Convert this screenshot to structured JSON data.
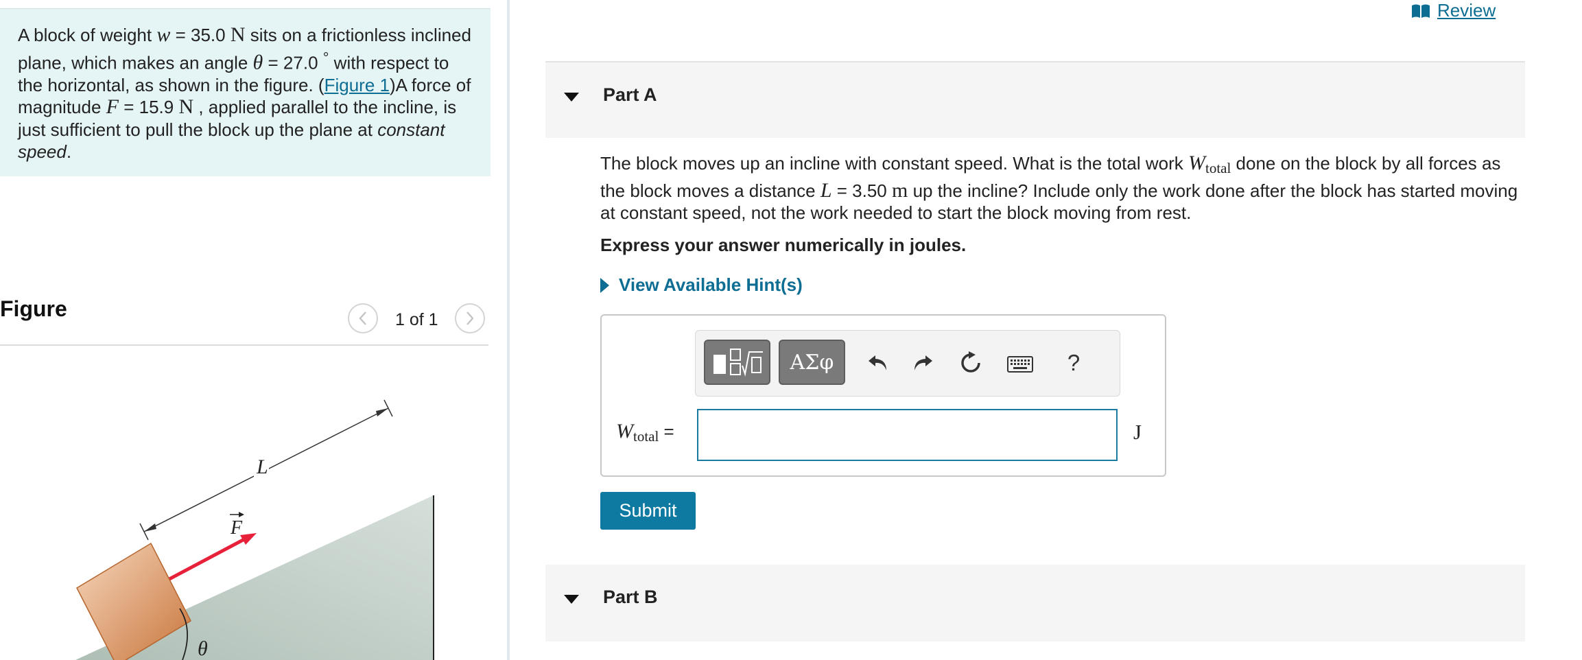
{
  "problem": {
    "part1": "A block of weight ",
    "w_symbol": "w",
    "part2": " = 35.0 ",
    "unit_N1": "N",
    "part3": " sits on a frictionless inclined plane, which makes an angle ",
    "theta_symbol": "θ",
    "part4": " = 27.0 ",
    "degree": "°",
    "part5": " with respect to the horizontal, as shown in the figure. (",
    "figure_link": "Figure 1",
    "part6": ")A force of magnitude ",
    "F_symbol": "F",
    "part7": " = 15.9 ",
    "unit_N2": "N",
    "part8": " , applied parallel to the incline, is just sufficient to pull the block up the plane at ",
    "emphasis": "constant speed",
    "part9": "."
  },
  "figure": {
    "title": "Figure",
    "counter": "1 of 1",
    "label_L": "L",
    "label_F": "F",
    "label_theta": "θ"
  },
  "review": {
    "label": "Review",
    "icon": "book-icon"
  },
  "partA": {
    "title": "Part A",
    "question_pre": "The block moves up an incline with constant speed. What is the total work ",
    "W_symbol": "W",
    "W_sub": "total",
    "question_mid": " done on the block by all forces as the block moves a distance ",
    "L_symbol": "L",
    "question_mid2": " = 3.50 ",
    "m_unit": "m",
    "question_post": " up the incline? Include only the work done after the block has started moving at constant speed, not the work needed to start the block moving from rest.",
    "instruction": "Express your answer numerically in joules.",
    "hint_label": "View Available Hint(s)",
    "toolbar": {
      "symbols_label": "ΑΣφ",
      "help_label": "?"
    },
    "answer_label_W": "W",
    "answer_label_sub": "total",
    "answer_label_eq": " =",
    "answer_value": "",
    "unit": "J",
    "submit_label": "Submit"
  },
  "partB": {
    "title": "Part B"
  },
  "colors": {
    "accent": "#0e7aa2",
    "link": "#0e6d93",
    "problem_bg": "#e5f4f5",
    "force_arrow": "#e8213b",
    "block": "#d88a4e",
    "incline": "#b9c8c0"
  }
}
